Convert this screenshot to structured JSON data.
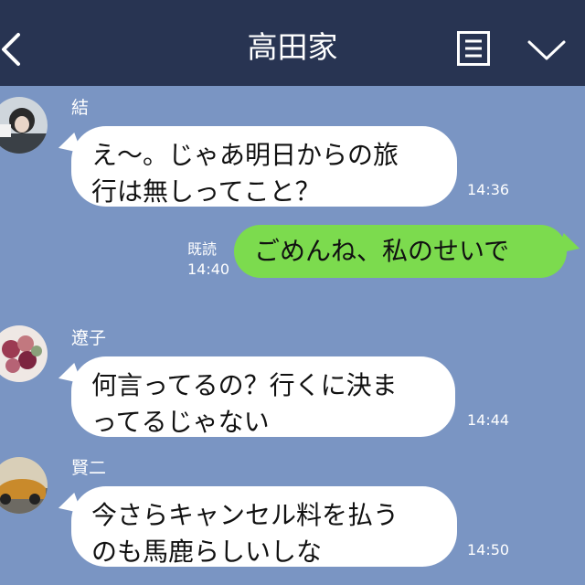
{
  "header": {
    "title": "高田家",
    "back_icon": "chevron-left-icon",
    "menu_icon": "list-icon",
    "expand_icon": "chevron-down-icon"
  },
  "messages": [
    {
      "sender": "結",
      "lines": [
        "え〜。じゃあ明日からの旅",
        "行は無しってこと？"
      ],
      "time": "14:36"
    },
    {
      "read_label": "既読",
      "lines": [
        "ごめんね、私のせいで"
      ],
      "time": "14:40"
    },
    {
      "sender": "遼子",
      "lines": [
        "何言ってるの？行くに決ま",
        "ってるじゃない"
      ],
      "time": "14:44"
    },
    {
      "sender": "賢二",
      "lines": [
        "今さらキャンセル料を払う",
        "のも馬鹿らしいしな"
      ],
      "time": "14:50"
    }
  ],
  "colors": {
    "background": "#7a95c3",
    "header": "#283452",
    "incoming_bubble": "#ffffff",
    "outgoing_bubble": "#7cdb4e"
  }
}
